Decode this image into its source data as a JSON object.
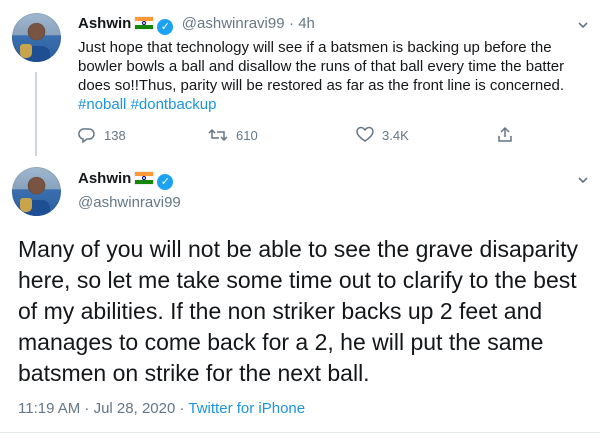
{
  "tweet1": {
    "name": "Ashwin",
    "handle": "@ashwinravi99",
    "time": "4h",
    "text_main": "Just hope that technology will see if a batsmen is backing up before the bowler bowls a ball and disallow the runs of that ball every time the batter does so!!Thus, parity will be restored as far as the front line is concerned.",
    "hashtag1": "#noball",
    "hashtag2": "#dontbackup",
    "replies": "138",
    "retweets": "610",
    "likes": "3.4K"
  },
  "tweet2": {
    "name": "Ashwin",
    "handle": "@ashwinravi99",
    "text": "Many of you will not be able to see the grave disaparity here, so let me take some time out to clarify to the best of my abilities. If the non striker backs up 2 feet and manages to come back for a 2, he will put the same batsmen on strike for the next ball.",
    "timestamp": "11:19 AM · Jul 28, 2020 · ",
    "source": "Twitter for iPhone"
  },
  "icons": {
    "caret": "chevron-down-icon",
    "reply": "reply-icon",
    "retweet": "retweet-icon",
    "like": "heart-icon",
    "share": "share-icon",
    "verified": "verified-badge-icon",
    "flag": "india-flag-icon"
  },
  "colors": {
    "link": "#1b95e0",
    "muted": "#657786",
    "text": "#14171a",
    "verified": "#1da1f2"
  }
}
